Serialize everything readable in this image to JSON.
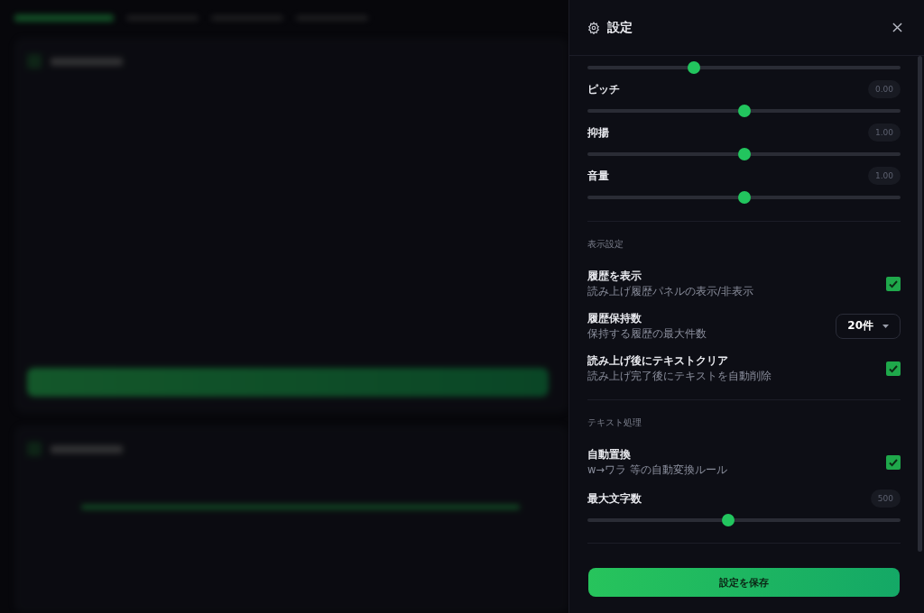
{
  "header": {
    "title": "設定"
  },
  "sections": [
    {
      "items": [
        {
          "kind": "slider",
          "level": 0.34
        },
        {
          "kind": "slider",
          "label": "ピッチ",
          "reading": "0.00",
          "level": 0.5
        },
        {
          "kind": "slider",
          "label": "抑揚",
          "reading": "1.00",
          "level": 0.5
        },
        {
          "kind": "slider",
          "label": "音量",
          "reading": "1.00",
          "level": 0.5
        }
      ]
    },
    {
      "title": "表示設定",
      "items": [
        {
          "kind": "checkbox",
          "label": "履歴を表示",
          "description": "読み上げ履歴パネルの表示/非表示",
          "checked": true
        },
        {
          "kind": "select",
          "label": "履歴保持数",
          "description": "保持する履歴の最大件数",
          "value": "20件"
        },
        {
          "kind": "checkbox",
          "label": "読み上げ後にテキストクリア",
          "description": "読み上げ完了後にテキストを自動削除",
          "checked": true
        }
      ]
    },
    {
      "title": "テキスト処理",
      "items": [
        {
          "kind": "checkbox",
          "label": "自動置換",
          "description": "w→ワラ 等の自動変換ルール",
          "checked": true
        },
        {
          "kind": "slider",
          "label": "最大文字数",
          "reading": "500",
          "level": 0.45
        }
      ]
    }
  ],
  "save_button": "設定を保存"
}
